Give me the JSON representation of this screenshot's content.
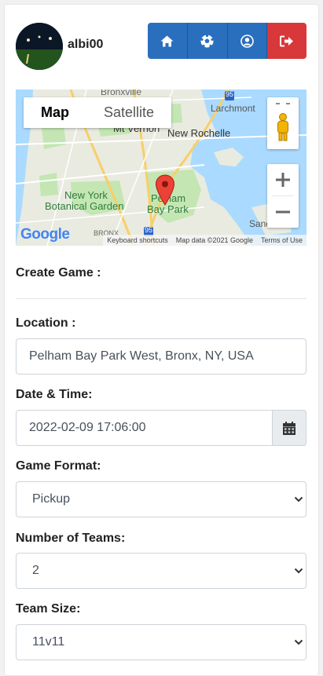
{
  "user": {
    "name": "albi00"
  },
  "nav": {
    "home": "home-icon",
    "games": "soccer-ball-icon",
    "profile": "user-circle-icon",
    "logout": "sign-out-icon"
  },
  "map": {
    "tabs": [
      "Map",
      "Satellite"
    ],
    "labels": {
      "bronxville": "Bronxville",
      "larchmont": "Larchmont",
      "mtvernon": "Mt Vernon",
      "newrochelle": "New Rochelle",
      "nybg1": "New York",
      "nybg2": "Botanical Garden",
      "pelham1": "Pelham",
      "pelham2": "Bay Park",
      "bronx": "BRONX",
      "sands": "Sands",
      "route": "95"
    },
    "logo": "Google",
    "attribution": [
      "Keyboard shortcuts",
      "Map data ©2021 Google",
      "Terms of Use"
    ]
  },
  "form": {
    "title": "Create Game :",
    "location": {
      "label": "Location :",
      "value": "Pelham Bay Park West, Bronx, NY, USA"
    },
    "datetime": {
      "label": "Date & Time:",
      "value": "2022-02-09 17:06:00"
    },
    "format": {
      "label": "Game Format:",
      "value": "Pickup"
    },
    "teams": {
      "label": "Number of Teams:",
      "value": "2"
    },
    "size": {
      "label": "Team Size:",
      "value": "11v11"
    }
  },
  "colors": {
    "primary": "#2a6fbe",
    "danger": "#d9383a",
    "map_water": "#aadaff",
    "map_park": "#c3e6b3",
    "marker": "#ea4335"
  }
}
